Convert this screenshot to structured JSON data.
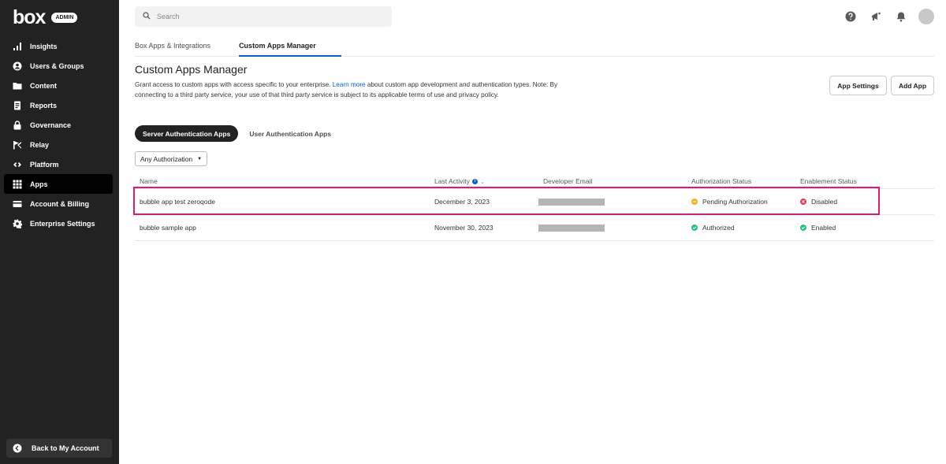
{
  "sidebar": {
    "logo": "box",
    "badge": "ADMIN",
    "items": [
      {
        "label": "Insights",
        "icon": "bar-chart-icon"
      },
      {
        "label": "Users & Groups",
        "icon": "user-icon"
      },
      {
        "label": "Content",
        "icon": "folder-icon"
      },
      {
        "label": "Reports",
        "icon": "report-icon"
      },
      {
        "label": "Governance",
        "icon": "lock-icon"
      },
      {
        "label": "Relay",
        "icon": "relay-icon"
      },
      {
        "label": "Platform",
        "icon": "platform-icon"
      },
      {
        "label": "Apps",
        "icon": "grid-icon"
      },
      {
        "label": "Account & Billing",
        "icon": "credit-card-icon"
      },
      {
        "label": "Enterprise Settings",
        "icon": "gear-icon"
      }
    ],
    "active_item": "Apps",
    "back_label": "Back to My Account"
  },
  "search": {
    "placeholder": "Search"
  },
  "topbar": {
    "icons": [
      "help-icon",
      "announcement-icon",
      "bell-icon",
      "avatar"
    ]
  },
  "tabs": [
    {
      "label": "Box Apps & Integrations",
      "active": false
    },
    {
      "label": "Custom Apps Manager",
      "active": true
    }
  ],
  "header": {
    "title": "Custom Apps Manager",
    "desc_before": "Grant access to custom apps with access specific to your enterprise. ",
    "desc_link": "Learn more",
    "desc_after": " about custom app development and authentication types. Note: By connecting to a third party service, your use of that third party service is subject to its applicable terms of use and privacy policy.",
    "app_settings_label": "App Settings",
    "add_app_label": "Add App"
  },
  "auth_toggle": {
    "server_label": "Server Authentication Apps",
    "user_label": "User Authentication Apps",
    "active": "server"
  },
  "filter": {
    "label": "Any Authorization"
  },
  "table": {
    "columns": [
      "Name",
      "Last Activity",
      "Developer Email",
      "Authorization Status",
      "Enablement Status"
    ],
    "rows": [
      {
        "name": "bubble app test zeroqode",
        "last_activity": "December 3, 2023",
        "developer_email": "",
        "auth_status": "Pending Authorization",
        "enable_status": "Disabled",
        "highlighted": true
      },
      {
        "name": "bubble sample app",
        "last_activity": "November 30, 2023",
        "developer_email": "",
        "auth_status": "Authorized",
        "enable_status": "Enabled",
        "highlighted": false
      }
    ]
  },
  "colors": {
    "sidebar_bg": "#222222",
    "accent": "#0061d5",
    "pending": "#f5b31b",
    "success": "#26c281",
    "error": "#ed3757",
    "highlight": "#e6186e"
  }
}
